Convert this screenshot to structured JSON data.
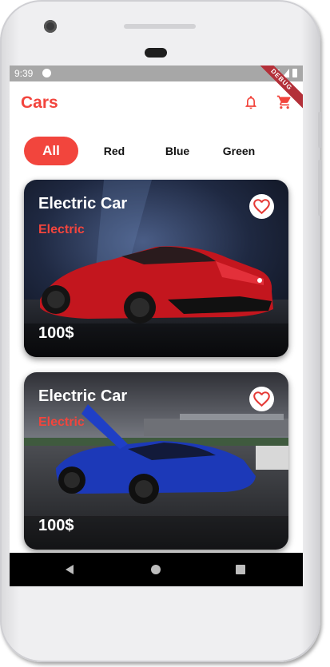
{
  "status_bar": {
    "time": "9:39"
  },
  "debug_banner": "DEBUG",
  "app_bar": {
    "title": "Cars",
    "icons": [
      "bell-icon",
      "cart-icon"
    ]
  },
  "tabs": [
    {
      "label": "All",
      "active": true
    },
    {
      "label": "Red",
      "active": false
    },
    {
      "label": "Blue",
      "active": false
    },
    {
      "label": "Green",
      "active": false
    }
  ],
  "cards": [
    {
      "title": "Electric Car",
      "subtitle": "Electric",
      "price": "100$",
      "favorite_icon": "heart-outline-icon"
    },
    {
      "title": "Electric Car",
      "subtitle": "Electric",
      "price": "100$",
      "favorite_icon": "heart-outline-icon"
    }
  ],
  "nav_bar": {
    "icons": [
      "back-icon",
      "home-icon",
      "recent-apps-icon"
    ]
  },
  "colors": {
    "accent": "#f2453d",
    "status_bar": "#a7a7a7",
    "nav_bar": "#000000"
  }
}
